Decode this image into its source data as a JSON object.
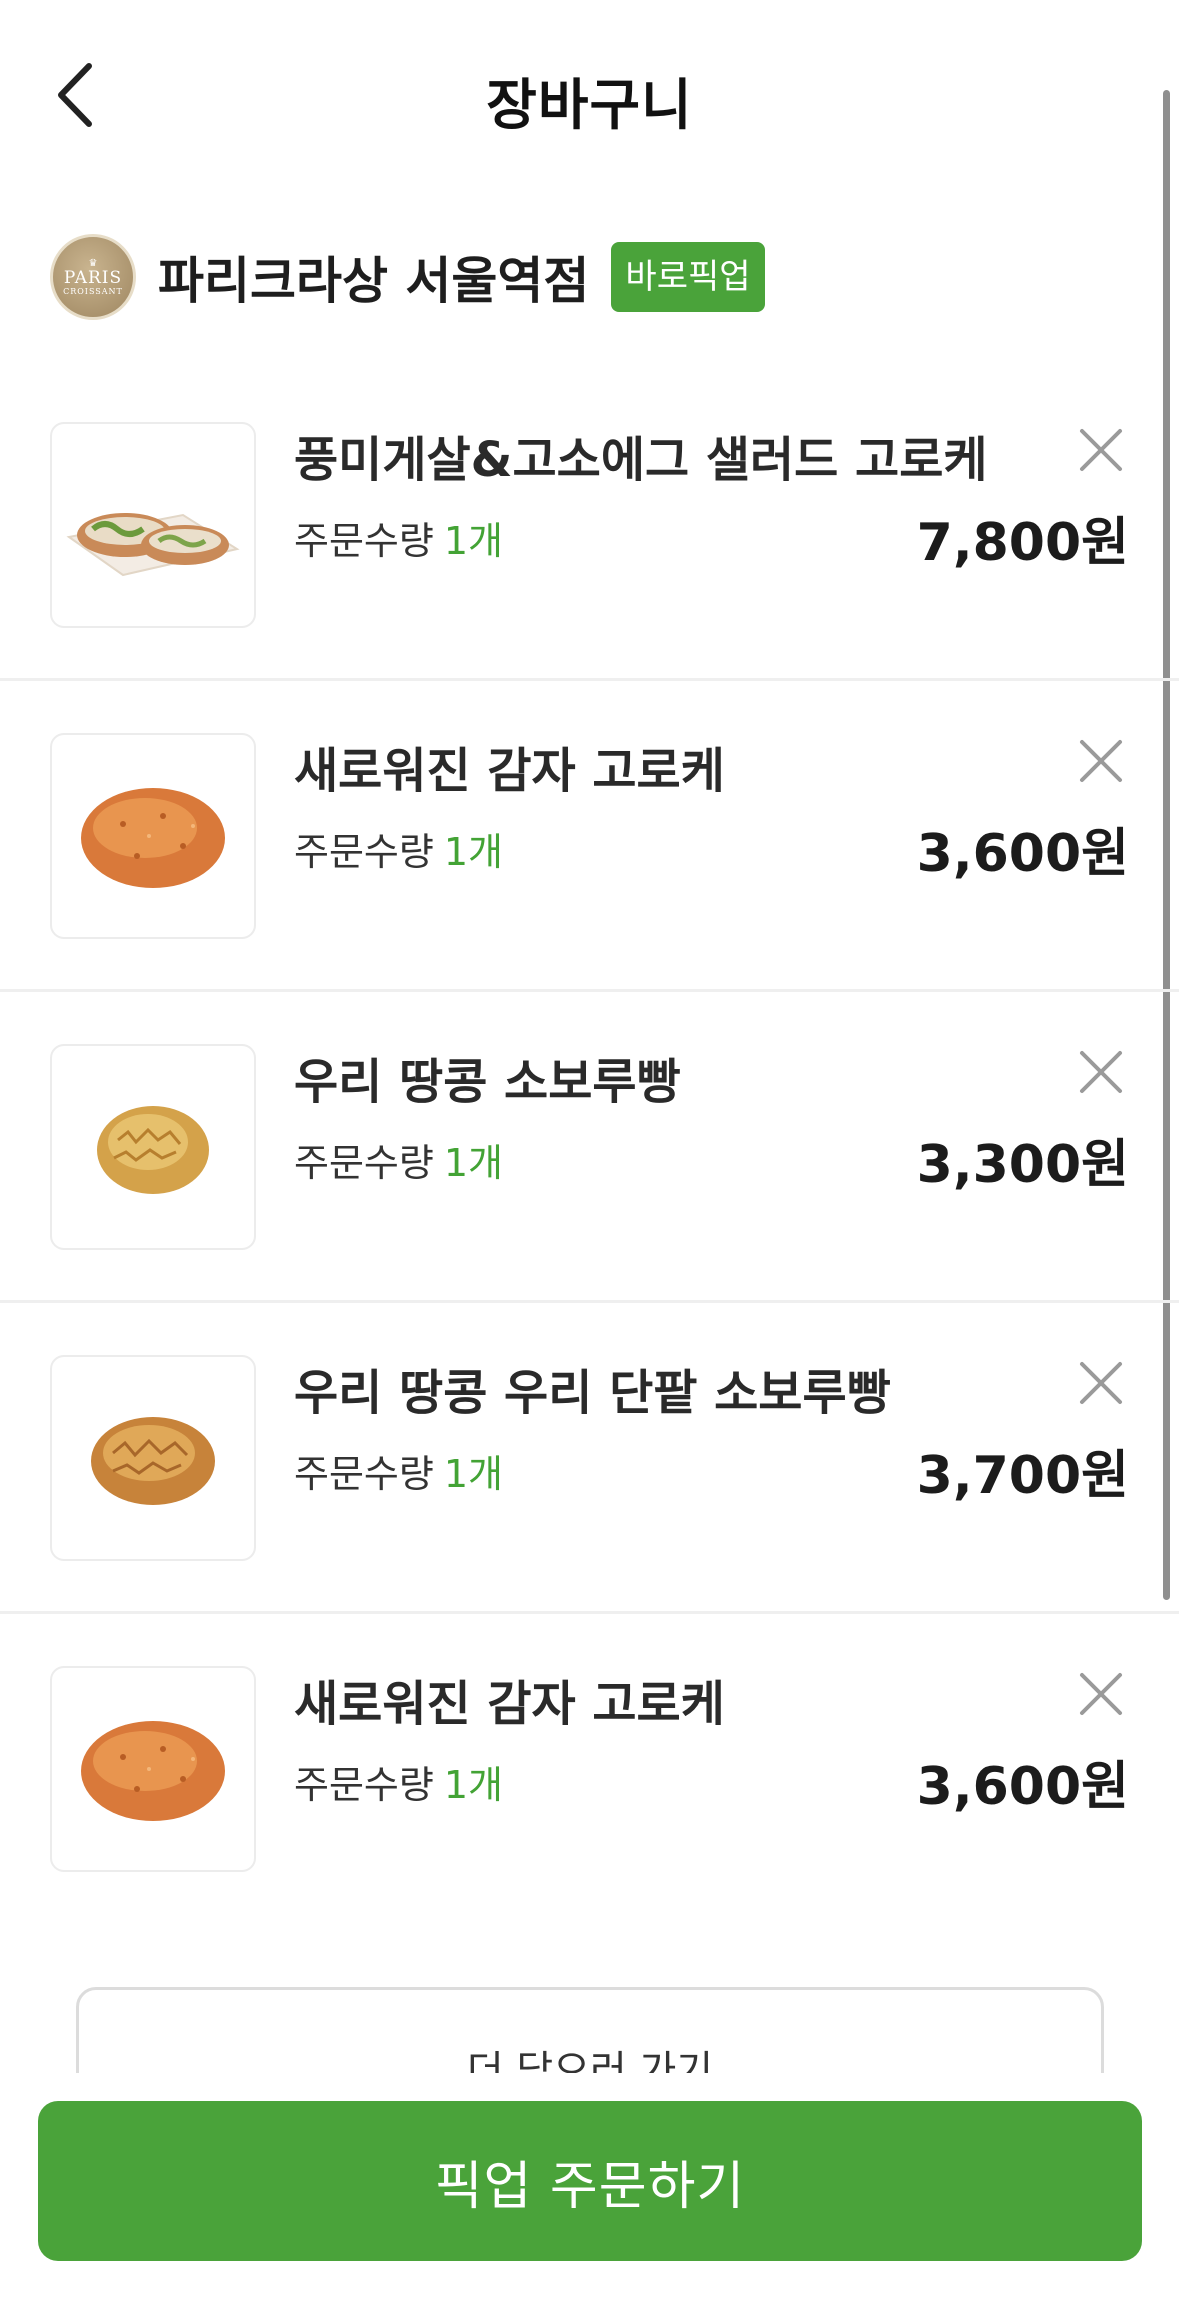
{
  "header": {
    "title": "장바구니",
    "back_icon": "chevron-left-icon"
  },
  "store": {
    "logo_line1": "PARIS",
    "logo_line2": "CROISSANT",
    "name": "파리크라상 서울역점",
    "badge": "바로픽업",
    "badge_color": "#4aa33a"
  },
  "cart": {
    "qty_label": "주문수량",
    "items": [
      {
        "name": "풍미게살&고소에그 샐러드 고로케",
        "qty": "1개",
        "price": "7,800원",
        "image": "croquette-sandwich"
      },
      {
        "name": "새로워진 감자 고로케",
        "qty": "1개",
        "price": "3,600원",
        "image": "potato-croquette"
      },
      {
        "name": "우리 땅콩 소보루빵",
        "qty": "1개",
        "price": "3,300원",
        "image": "peanut-soboro"
      },
      {
        "name": "우리 땅콩 우리 단팥 소보루빵",
        "qty": "1개",
        "price": "3,700원",
        "image": "redbean-soboro"
      },
      {
        "name": "새로워진 감자 고로케",
        "qty": "1개",
        "price": "3,600원",
        "image": "potato-croquette"
      }
    ]
  },
  "more_button": {
    "label": "더 담으러 가기"
  },
  "order_button": {
    "label": "픽업 주문하기"
  },
  "colors": {
    "accent": "#4aa33a",
    "qty_green": "#43a335",
    "divider": "#efefef"
  }
}
